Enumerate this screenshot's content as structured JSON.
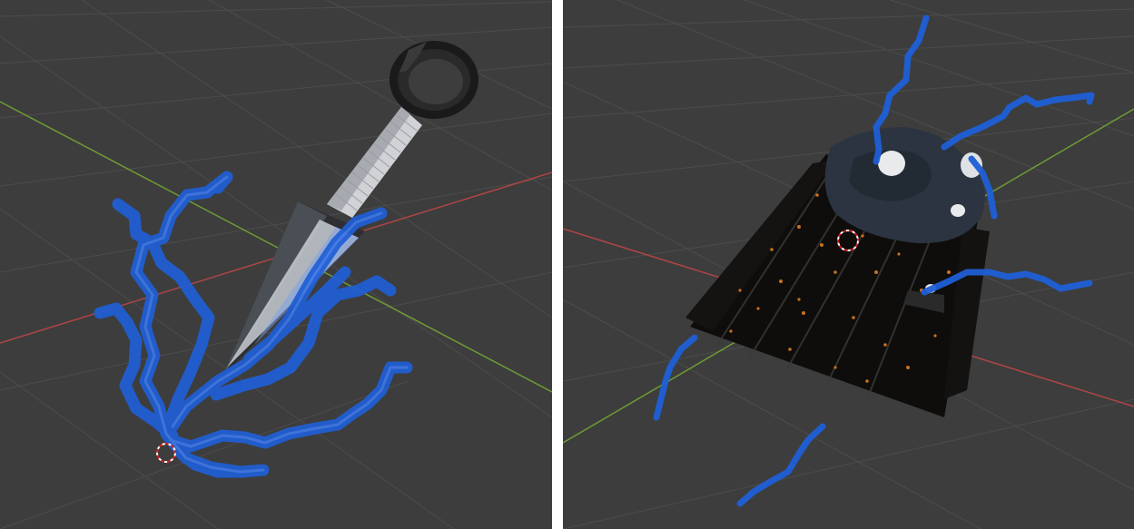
{
  "colors": {
    "viewport_bg": "#3d3d3d",
    "grid_line": "#4c4c4c",
    "axis_x": "#b04545",
    "axis_y": "#6f9a35",
    "lightning": "#1f5fd6",
    "lightning_glow": "#2f6ff0",
    "blade_dark": "#2d2f33",
    "blade_light": "#c8ccd4",
    "handle_wrap": "#d0d2d6",
    "ring": "#1a1a1a",
    "can_body": "#0e0d0c",
    "can_speckle": "#c9711a",
    "can_lid": "#2b3440",
    "cursor_red": "#d02020",
    "separator": "#ffffff"
  },
  "viewports": [
    {
      "id": "left",
      "object": "kunai-icon"
    },
    {
      "id": "right",
      "object": "can-icon"
    }
  ],
  "cursor": {
    "icon": "3d-cursor-icon"
  }
}
